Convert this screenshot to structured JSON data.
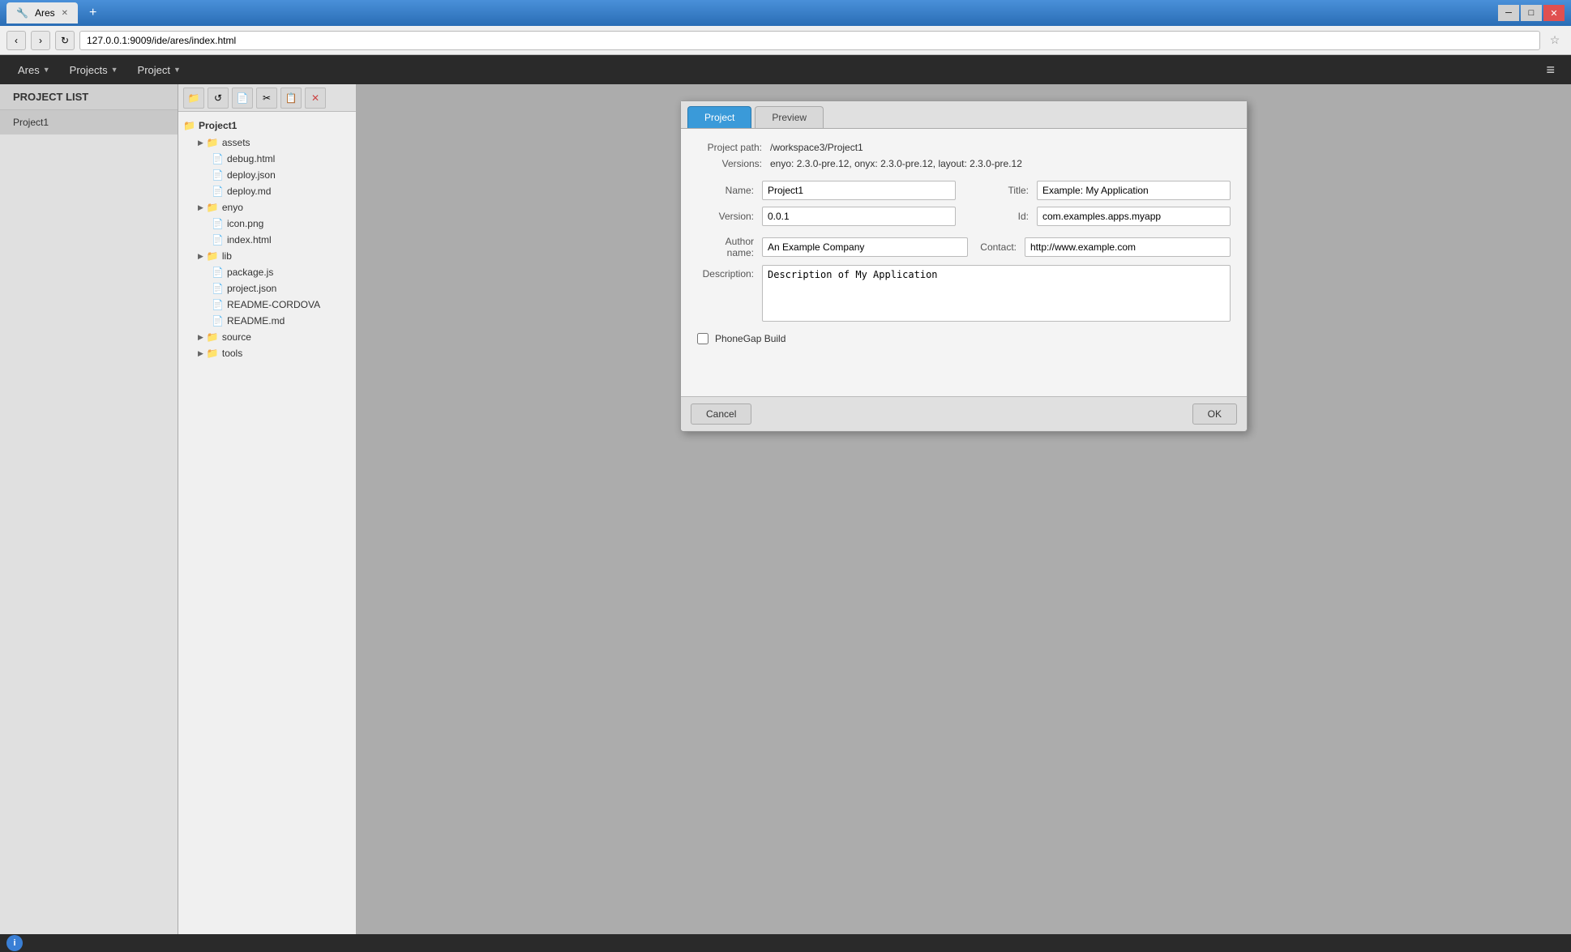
{
  "browser": {
    "tab_title": "Ares",
    "address": "127.0.0.1:9009/ide/ares/index.html",
    "new_tab_label": "+",
    "nav_back": "‹",
    "nav_forward": "›",
    "nav_reload": "↻"
  },
  "toolbar": {
    "ares_label": "Ares",
    "projects_label": "Projects",
    "project_label": "Project",
    "hamburger": "≡"
  },
  "sidebar": {
    "header": "PROJECT LIST",
    "items": [
      {
        "label": "Project1"
      }
    ]
  },
  "file_tree": {
    "root": "Project1",
    "toolbar_buttons": [
      {
        "icon": "📁",
        "title": "New folder"
      },
      {
        "icon": "↺",
        "title": "Refresh"
      },
      {
        "icon": "📄",
        "title": "New file"
      },
      {
        "icon": "✂",
        "title": "Cut"
      },
      {
        "icon": "📋",
        "title": "Paste"
      },
      {
        "icon": "✕",
        "title": "Delete",
        "disabled": false
      }
    ],
    "items": [
      {
        "type": "folder",
        "label": "assets",
        "indent": 1
      },
      {
        "type": "file",
        "label": "debug.html",
        "indent": 1
      },
      {
        "type": "file",
        "label": "deploy.json",
        "indent": 1
      },
      {
        "type": "file",
        "label": "deploy.md",
        "indent": 1
      },
      {
        "type": "folder",
        "label": "enyo",
        "indent": 1
      },
      {
        "type": "file",
        "label": "icon.png",
        "indent": 1
      },
      {
        "type": "file",
        "label": "index.html",
        "indent": 1
      },
      {
        "type": "folder",
        "label": "lib",
        "indent": 1
      },
      {
        "type": "file",
        "label": "package.js",
        "indent": 1
      },
      {
        "type": "file",
        "label": "project.json",
        "indent": 1
      },
      {
        "type": "file",
        "label": "README-CORDOVA",
        "indent": 1
      },
      {
        "type": "file",
        "label": "README.md",
        "indent": 1
      },
      {
        "type": "folder",
        "label": "source",
        "indent": 1
      },
      {
        "type": "folder",
        "label": "tools",
        "indent": 1
      }
    ]
  },
  "dialog": {
    "tabs": [
      {
        "label": "Project",
        "active": true
      },
      {
        "label": "Preview",
        "active": false
      }
    ],
    "project_path_label": "Project path:",
    "project_path_value": "/workspace3/Project1",
    "versions_label": "Versions:",
    "versions_value": "enyo: 2.3.0-pre.12, onyx: 2.3.0-pre.12, layout: 2.3.0-pre.12",
    "fields": {
      "name_label": "Name:",
      "name_value": "Project1",
      "title_label": "Title:",
      "title_value": "Example: My Application",
      "version_label": "Version:",
      "version_value": "0.0.1",
      "id_label": "Id:",
      "id_value": "com.examples.apps.myapp",
      "author_name_label": "Author name:",
      "author_name_value": "An Example Company",
      "contact_label": "Contact:",
      "contact_value": "http://www.example.com",
      "description_label": "Description:",
      "description_value": "Description of My Application"
    },
    "phonegap_label": "PhoneGap Build",
    "phonegap_checked": false,
    "cancel_label": "Cancel",
    "ok_label": "OK"
  },
  "status": {
    "icon": "i"
  }
}
